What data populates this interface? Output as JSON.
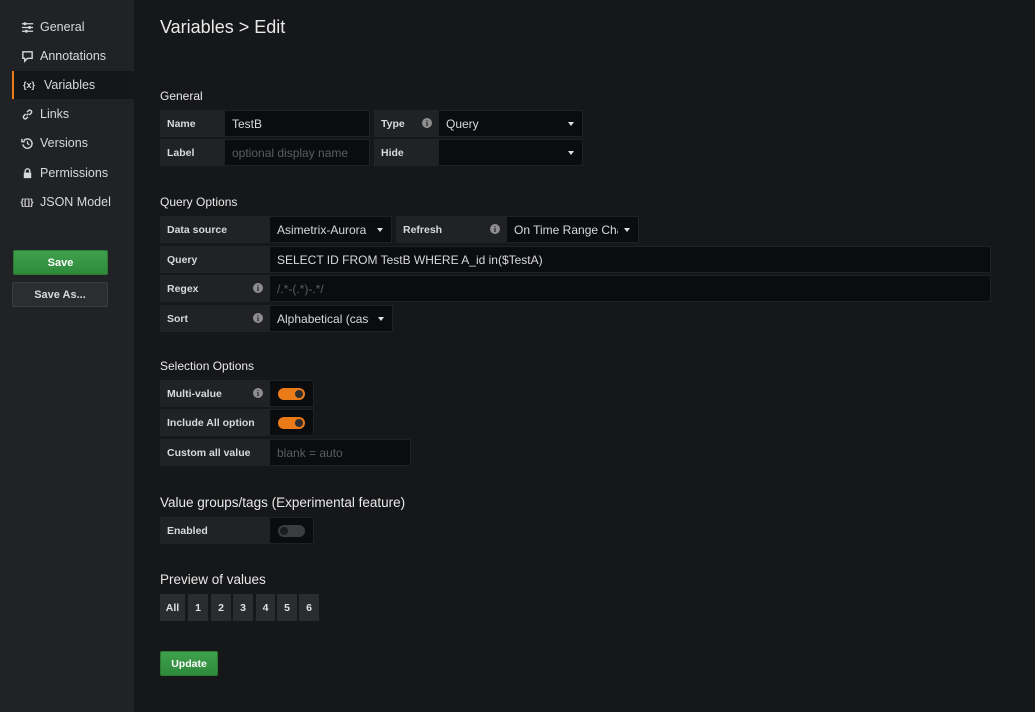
{
  "sidebar": {
    "items": [
      {
        "label": "General",
        "icon": "sliders-icon"
      },
      {
        "label": "Annotations",
        "icon": "comment-icon"
      },
      {
        "label": "Variables",
        "icon": "variable-icon",
        "active": true
      },
      {
        "label": "Links",
        "icon": "link-icon"
      },
      {
        "label": "Versions",
        "icon": "history-icon"
      },
      {
        "label": "Permissions",
        "icon": "lock-icon"
      },
      {
        "label": "JSON Model",
        "icon": "json-icon"
      }
    ],
    "save_label": "Save",
    "save_as_label": "Save As..."
  },
  "page": {
    "title": "Variables > Edit"
  },
  "general": {
    "heading": "General",
    "name_label": "Name",
    "name_value": "TestB",
    "type_label": "Type",
    "type_value": "Query",
    "label_label": "Label",
    "label_placeholder": "optional display name",
    "hide_label": "Hide",
    "hide_value": ""
  },
  "query_options": {
    "heading": "Query Options",
    "datasource_label": "Data source",
    "datasource_value": "Asimetrix-Aurora",
    "refresh_label": "Refresh",
    "refresh_value": "On Time Range Char",
    "query_label": "Query",
    "query_value": "SELECT ID FROM TestB WHERE A_id in($TestA)",
    "regex_label": "Regex",
    "regex_placeholder": "/.*-(.*)-.*/",
    "sort_label": "Sort",
    "sort_value": "Alphabetical (case"
  },
  "selection_options": {
    "heading": "Selection Options",
    "multi_value_label": "Multi-value",
    "multi_value_on": true,
    "include_all_label": "Include All option",
    "include_all_on": true,
    "custom_all_label": "Custom all value",
    "custom_all_placeholder": "blank = auto"
  },
  "value_groups": {
    "heading": "Value groups/tags (Experimental feature)",
    "enabled_label": "Enabled",
    "enabled_on": false
  },
  "preview": {
    "heading": "Preview of values",
    "values": [
      "All",
      "1",
      "2",
      "3",
      "4",
      "5",
      "6"
    ]
  },
  "update_label": "Update",
  "colors": {
    "accent": "#eb7b18",
    "primary_button": "#3ea04d",
    "background": "#161719",
    "panel": "#202226"
  }
}
